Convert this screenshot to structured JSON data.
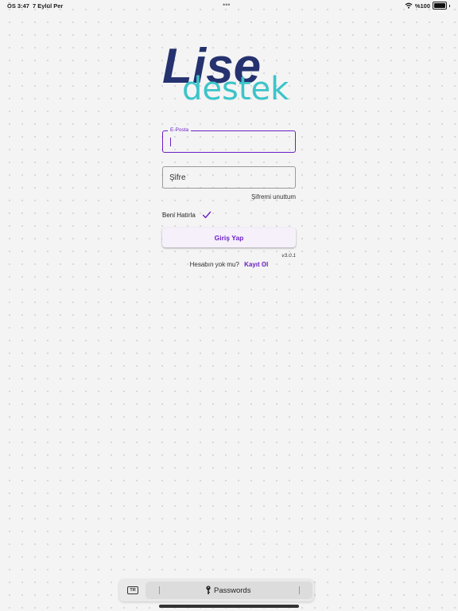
{
  "status_bar": {
    "time": "ÖS 3:47",
    "date": "7 Eylül Per",
    "dots": "•••",
    "battery": "%100"
  },
  "logo": {
    "text_primary": "Lise",
    "text_secondary": "destek"
  },
  "form": {
    "email": {
      "label": "E-Posta",
      "value": ""
    },
    "password": {
      "placeholder": "Şifre"
    },
    "forgot_label": "Şifremi unuttum",
    "remember_label": "Beni Hatırla",
    "remember_checked": true,
    "login_label": "Giriş Yap",
    "version": "v3.0.1",
    "no_account_text": "Hesabın yok mu?",
    "signup_label": "Kayıt Ol"
  },
  "keyboard_bar": {
    "lang": "TR",
    "passwords_label": "Passwords"
  },
  "colors": {
    "accent": "#6a1fc4",
    "logo_navy": "#25326f",
    "logo_teal": "#3cc4c9"
  }
}
